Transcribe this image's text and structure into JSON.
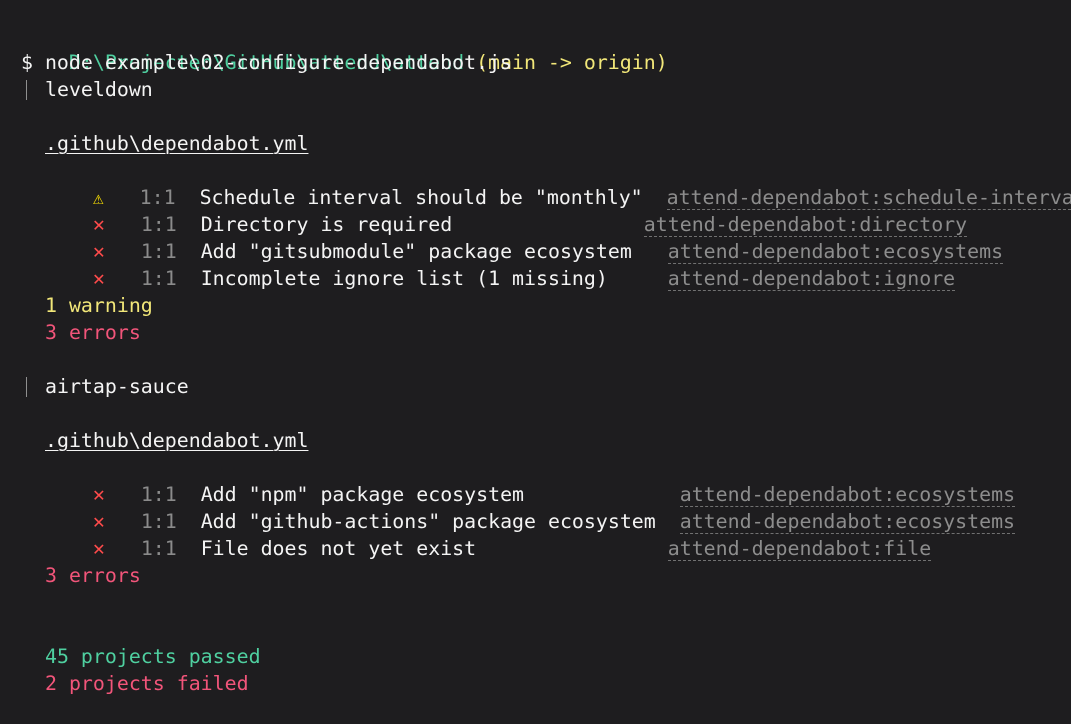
{
  "prompt": {
    "path": "D:\\Projecten\\GitHub\\attend\\attend",
    "branch": "(main -> origin)"
  },
  "command": "$ node example\\02-configure-dependabot.js",
  "projects": [
    {
      "name": "leveldown",
      "file": ".github\\dependabot.yml",
      "issues": [
        {
          "severity": "warning",
          "icon": "warning-icon",
          "loc": "1:1",
          "message": "Schedule interval should be \"monthly\"",
          "rule": "attend-dependabot:schedule-interval"
        },
        {
          "severity": "error",
          "icon": "error-icon",
          "loc": "1:1",
          "message": "Directory is required",
          "rule": "attend-dependabot:directory"
        },
        {
          "severity": "error",
          "icon": "error-icon",
          "loc": "1:1",
          "message": "Add \"gitsubmodule\" package ecosystem",
          "rule": "attend-dependabot:ecosystems"
        },
        {
          "severity": "error",
          "icon": "error-icon",
          "loc": "1:1",
          "message": "Incomplete ignore list (1 missing)",
          "rule": "attend-dependabot:ignore"
        }
      ],
      "summary": [
        "1 warning",
        "3 errors"
      ]
    },
    {
      "name": "airtap-sauce",
      "file": ".github\\dependabot.yml",
      "issues": [
        {
          "severity": "error",
          "icon": "error-icon",
          "loc": "1:1",
          "message": "Add \"npm\" package ecosystem",
          "rule": "attend-dependabot:ecosystems"
        },
        {
          "severity": "error",
          "icon": "error-icon",
          "loc": "1:1",
          "message": "Add \"github-actions\" package ecosystem",
          "rule": "attend-dependabot:ecosystems"
        },
        {
          "severity": "error",
          "icon": "error-icon",
          "loc": "1:1",
          "message": "File does not yet exist",
          "rule": "attend-dependabot:file"
        }
      ],
      "summary": [
        "3 errors"
      ]
    }
  ],
  "totals": {
    "passed": "45 projects passed",
    "failed": "2 projects failed"
  },
  "colors": {
    "background": "#1e1d1f",
    "foreground": "#f4f4f4",
    "green": "#4fd0a0",
    "yellow": "#f2e779",
    "red": "#f2557a",
    "dim": "#8b8b8b"
  }
}
